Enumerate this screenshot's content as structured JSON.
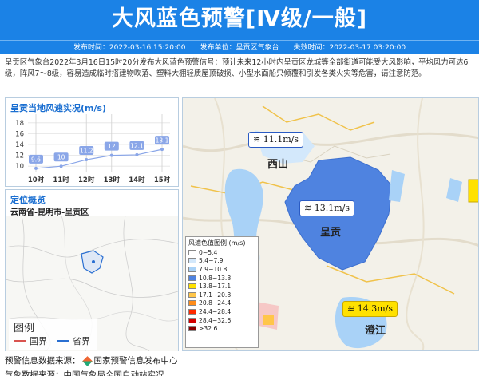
{
  "banner": {
    "title": "大风蓝色预警[Ⅳ级/一般]"
  },
  "info": {
    "publish_time": "发布时间：2022-03-16 15:20:00",
    "publisher": "发布单位：呈贡区气象台",
    "expire_time": "失效时间：2022-03-17 03:20:00"
  },
  "description": "呈贡区气象台2022年3月16日15时20分发布大风蓝色预警信号：预计未来12小时内呈贡区龙城等全部街道可能受大风影响，平均风力可达6级，阵风7～8级，容易造成临时搭建物吹落、塑料大棚轻质屋顶破损、小型水面船只倾覆和引发各类火灾等危害，请注意防范。",
  "chart_panel": {
    "title": "呈贡当地风速实况(m/s)"
  },
  "chart_data": {
    "type": "line",
    "title": "呈贡当地风速实况(m/s)",
    "categories": [
      "10时",
      "11时",
      "12时",
      "13时",
      "14时",
      "15时"
    ],
    "values": [
      9.6,
      10,
      11.2,
      12,
      12.1,
      13.1
    ],
    "yticks": [
      10,
      12,
      14,
      16,
      18
    ],
    "ylim": [
      9,
      19
    ],
    "grid": true,
    "color": "#8aa6e8"
  },
  "location_panel": {
    "title": "定位概览",
    "path": "云南省-昆明市-呈贡区",
    "legend_title": "图例",
    "legend_items": [
      {
        "label": "国界",
        "color": "#d9534f"
      },
      {
        "label": "省界",
        "color": "#2a6fd1"
      }
    ]
  },
  "map": {
    "wind_labels": [
      {
        "value": "11.1m/s",
        "style": "white"
      },
      {
        "value": "13.1m/s",
        "style": "white"
      },
      {
        "value": "14.3m/s",
        "style": "yellow"
      }
    ],
    "places": [
      "西山",
      "呈贡",
      "澄江"
    ],
    "legend_title": "风速色值图例 (m/s)",
    "legend": [
      {
        "range": "0~5.4",
        "color": "#ffffff"
      },
      {
        "range": "5.4~7.9",
        "color": "#d3e8fb"
      },
      {
        "range": "7.9~10.8",
        "color": "#a9d2f7"
      },
      {
        "range": "10.8~13.8",
        "color": "#4f83e0"
      },
      {
        "range": "13.8~17.1",
        "color": "#ffe100"
      },
      {
        "range": "17.1~20.8",
        "color": "#ffc64a"
      },
      {
        "range": "20.8~24.4",
        "color": "#ff8c1a"
      },
      {
        "range": "24.4~28.4",
        "color": "#ff2a00"
      },
      {
        "range": "28.4~32.6",
        "color": "#d40000"
      },
      {
        "range": ">32.6",
        "color": "#8b0000"
      }
    ]
  },
  "footer": {
    "source_label": "预警信息数据来源：",
    "source_name": "国家预警信息发布中心",
    "weather_label": "气象数据来源：中国气象局全国自动站实况"
  }
}
